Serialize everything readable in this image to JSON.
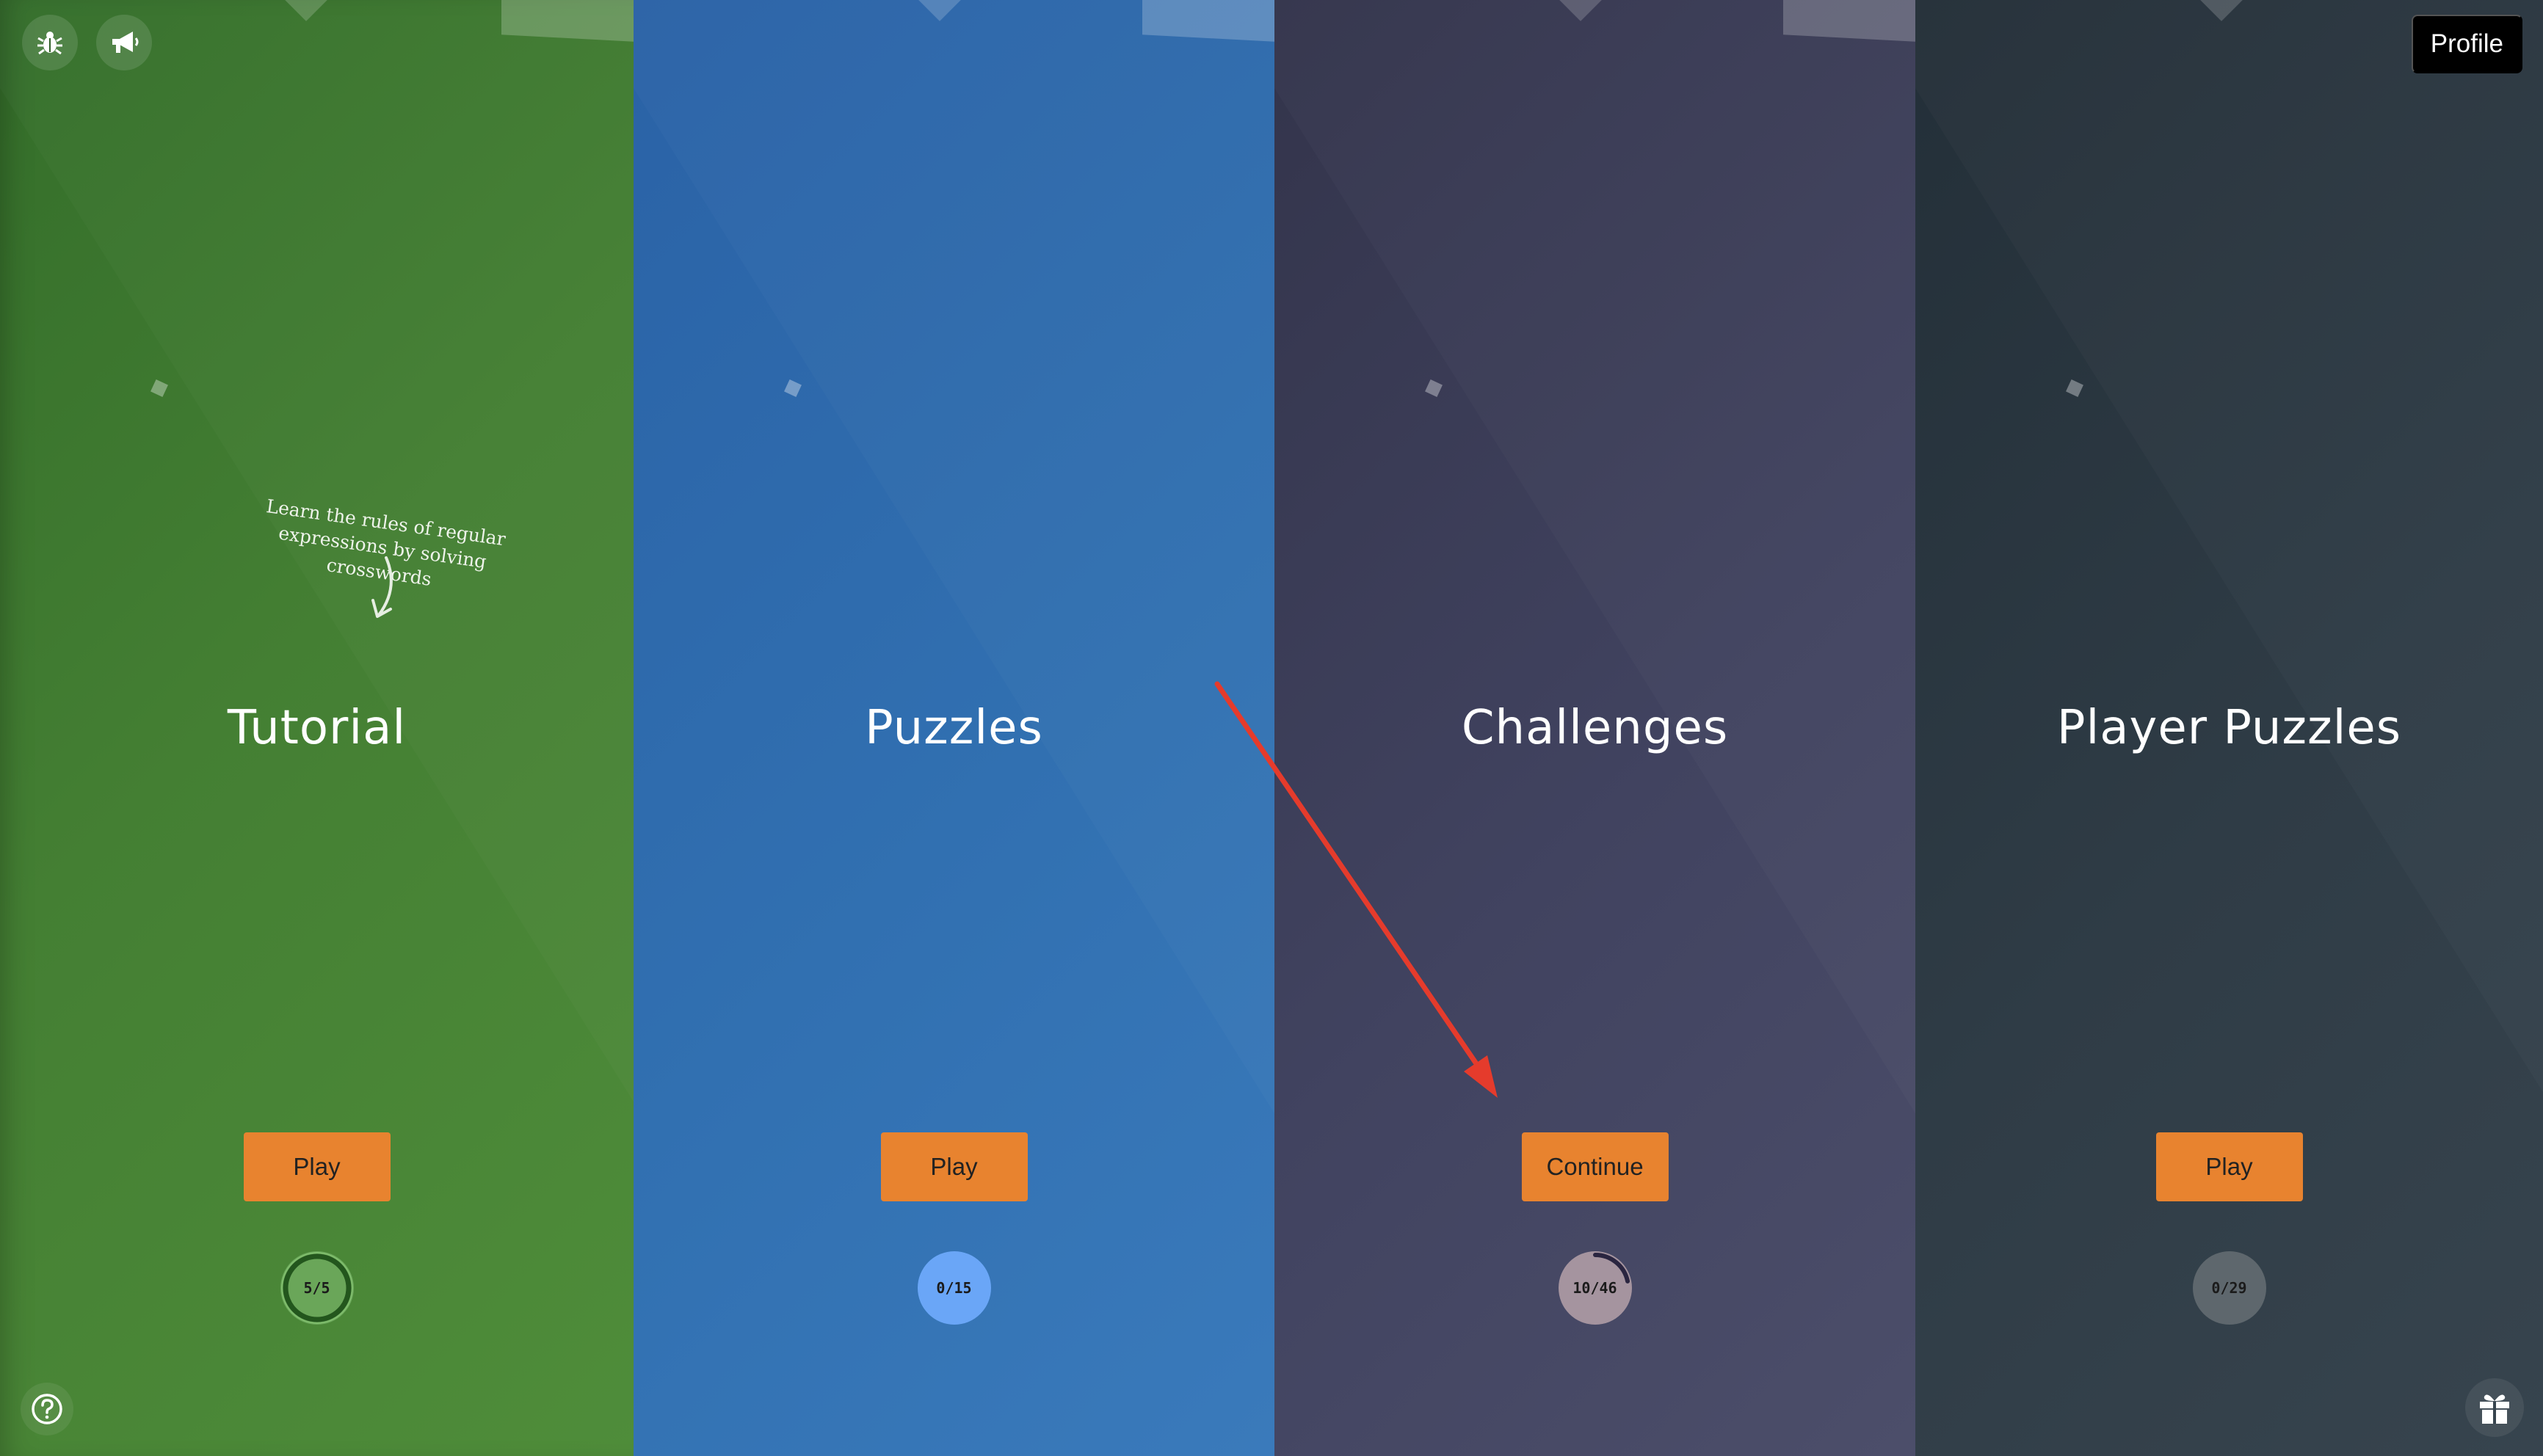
{
  "sections": [
    {
      "title": "Tutorial",
      "button": "Play",
      "progress": "5/5",
      "completed": 5,
      "total": 5
    },
    {
      "title": "Puzzles",
      "button": "Play",
      "progress": "0/15",
      "completed": 0,
      "total": 15
    },
    {
      "title": "Challenges",
      "button": "Continue",
      "progress": "10/46",
      "completed": 10,
      "total": 46
    },
    {
      "title": "Player Puzzles",
      "button": "Play",
      "progress": "0/29",
      "completed": 0,
      "total": 29
    }
  ],
  "tutorial_tagline": "Learn the rules of regular expressions by solving crosswords",
  "header": {
    "profile_label": "Profile"
  },
  "icons": [
    "bug-icon",
    "megaphone-icon",
    "help-icon",
    "gift-icon"
  ],
  "colors": {
    "tutorial": "#447f33",
    "puzzles": "#3170b1",
    "challenges": "#414360",
    "player_puzzles": "#2f3c46",
    "button": "#e8832f",
    "annotation_arrow": "#e53b2c"
  }
}
